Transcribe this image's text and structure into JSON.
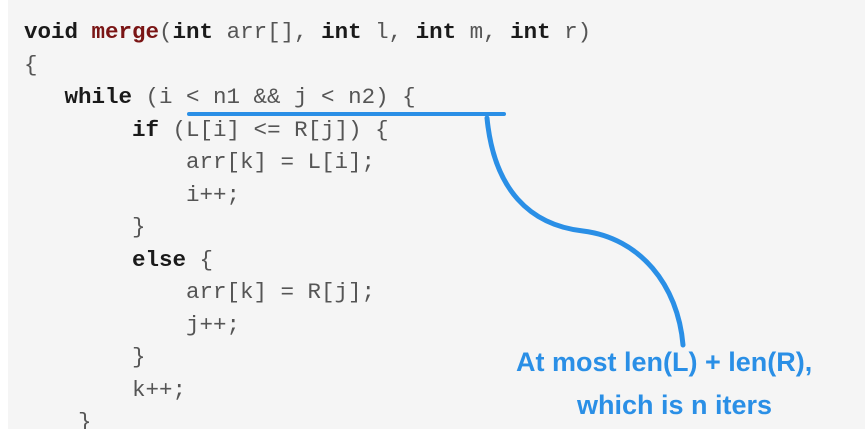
{
  "code": {
    "lines": [
      [
        {
          "t": "void ",
          "c": "kw"
        },
        {
          "t": "merge",
          "c": "fn"
        },
        {
          "t": "(",
          "c": "pl"
        },
        {
          "t": "int",
          "c": "kw"
        },
        {
          "t": " arr[], ",
          "c": "pl"
        },
        {
          "t": "int",
          "c": "kw"
        },
        {
          "t": " l, ",
          "c": "pl"
        },
        {
          "t": "int",
          "c": "kw"
        },
        {
          "t": " m, ",
          "c": "pl"
        },
        {
          "t": "int",
          "c": "kw"
        },
        {
          "t": " r)",
          "c": "pl"
        }
      ],
      [
        {
          "t": "{",
          "c": "pl"
        }
      ],
      [
        {
          "t": "   ",
          "c": "pl"
        },
        {
          "t": "while",
          "c": "kw"
        },
        {
          "t": " (i < n1 && j < n2) {",
          "c": "pl"
        }
      ],
      [
        {
          "t": "        ",
          "c": "pl"
        },
        {
          "t": "if",
          "c": "kw"
        },
        {
          "t": " (L[i] <= R[j]) {",
          "c": "pl"
        }
      ],
      [
        {
          "t": "            arr[k] = L[i];",
          "c": "pl"
        }
      ],
      [
        {
          "t": "            i++;",
          "c": "pl"
        }
      ],
      [
        {
          "t": "        }",
          "c": "pl"
        }
      ],
      [
        {
          "t": "        ",
          "c": "pl"
        },
        {
          "t": "else",
          "c": "kw"
        },
        {
          "t": " {",
          "c": "pl"
        }
      ],
      [
        {
          "t": "            arr[k] = R[j];",
          "c": "pl"
        }
      ],
      [
        {
          "t": "            j++;",
          "c": "pl"
        }
      ],
      [
        {
          "t": "        }",
          "c": "pl"
        }
      ],
      [
        {
          "t": "        k++;",
          "c": "pl"
        }
      ],
      [
        {
          "t": "    }",
          "c": "pl"
        }
      ]
    ]
  },
  "annotation": {
    "line1": "At most len(L) + len(R),",
    "line2": "which is n iters",
    "color": "#2a8fe6"
  },
  "colors": {
    "panel_bg": "#f5f5f5",
    "keyword": "#1a1a1a",
    "function_name": "#7a1515",
    "plain": "#555555"
  }
}
